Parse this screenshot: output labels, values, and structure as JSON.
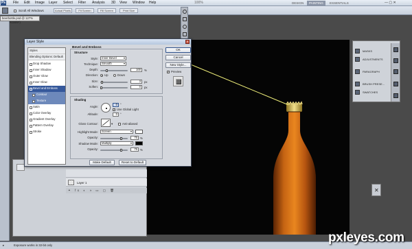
{
  "menubar": {
    "logo": "Ps",
    "items": [
      "File",
      "Edit",
      "Image",
      "Layer",
      "Select",
      "Filter",
      "Analysis",
      "3D",
      "View",
      "Window",
      "Help"
    ],
    "zoom": "100%",
    "workspaces": [
      "DESIGN",
      "PAINTING",
      "ESSENTIALS"
    ],
    "active_workspace": "PAINTING"
  },
  "optbar": {
    "scroll_all_windows": "Scroll All Windows",
    "buttons": [
      "Actual Pixels",
      "Fit Screen",
      "Fill Screen",
      "Print Size"
    ]
  },
  "document": {
    "tab_title": "beerbottle.psd @ 127% (cap, RGB/8*)"
  },
  "dialog": {
    "title": "Layer Style",
    "styles_header": "Styles",
    "blending_options": "Blending Options: Default",
    "styles": [
      {
        "label": "Drop Shadow",
        "checked": false
      },
      {
        "label": "Inner Shadow",
        "checked": false
      },
      {
        "label": "Outer Glow",
        "checked": false
      },
      {
        "label": "Inner Glow",
        "checked": false
      },
      {
        "label": "Bevel and Emboss",
        "checked": true,
        "selected": true
      },
      {
        "label": "Contour",
        "checked": false,
        "sub": true
      },
      {
        "label": "Texture",
        "checked": false,
        "sub": true
      },
      {
        "label": "Satin",
        "checked": false
      },
      {
        "label": "Color Overlay",
        "checked": false
      },
      {
        "label": "Gradient Overlay",
        "checked": false
      },
      {
        "label": "Pattern Overlay",
        "checked": false
      },
      {
        "label": "Stroke",
        "checked": false
      }
    ],
    "bevel": {
      "group_title": "Bevel and Emboss",
      "structure_title": "Structure",
      "style_label": "Style:",
      "style_value": "Inner Bevel",
      "technique_label": "Technique:",
      "technique_value": "Smooth",
      "depth_label": "Depth:",
      "depth_value": "100",
      "depth_unit": "%",
      "direction_label": "Direction:",
      "direction_up": "Up",
      "direction_down": "Down",
      "size_label": "Size:",
      "size_value": "3",
      "size_unit": "px",
      "soften_label": "Soften:",
      "soften_value": "0",
      "soften_unit": "px"
    },
    "shading": {
      "title": "Shading",
      "angle_label": "Angle:",
      "angle_value": "0",
      "use_global_light": "Use Global Light",
      "altitude_label": "Altitude:",
      "altitude_value": "0",
      "gloss_contour_label": "Gloss Contour:",
      "anti_aliased": "Anti-aliased",
      "highlight_mode_label": "Highlight Mode:",
      "highlight_mode_value": "Screen",
      "highlight_opacity_label": "Opacity:",
      "highlight_opacity_value": "75",
      "shadow_mode_label": "Shadow Mode:",
      "shadow_mode_value": "Multiply",
      "shadow_opacity_label": "Opacity:",
      "shadow_opacity_value": "75",
      "opacity_unit": "%"
    },
    "make_default": "Make Default",
    "reset_to_default": "Reset to Default",
    "buttons": {
      "ok": "OK",
      "cancel": "Cancel",
      "new_style": "New Style...",
      "preview": "Preview"
    }
  },
  "right_panel": {
    "items": [
      "MASKS",
      "ADJUSTMENTS",
      "PARAGRAPH",
      "BRUSH PRESE...",
      "SWATCHES"
    ]
  },
  "layers": {
    "layer_name": "Layer 1"
  },
  "status": {
    "text": "Exposure works in 32-bit only"
  },
  "watermark": "pxleyes.com",
  "colors": {
    "accent": "#35589b",
    "canvas_bg": "#050505",
    "bottle": "#b85a10",
    "cap": "#c9b451"
  }
}
